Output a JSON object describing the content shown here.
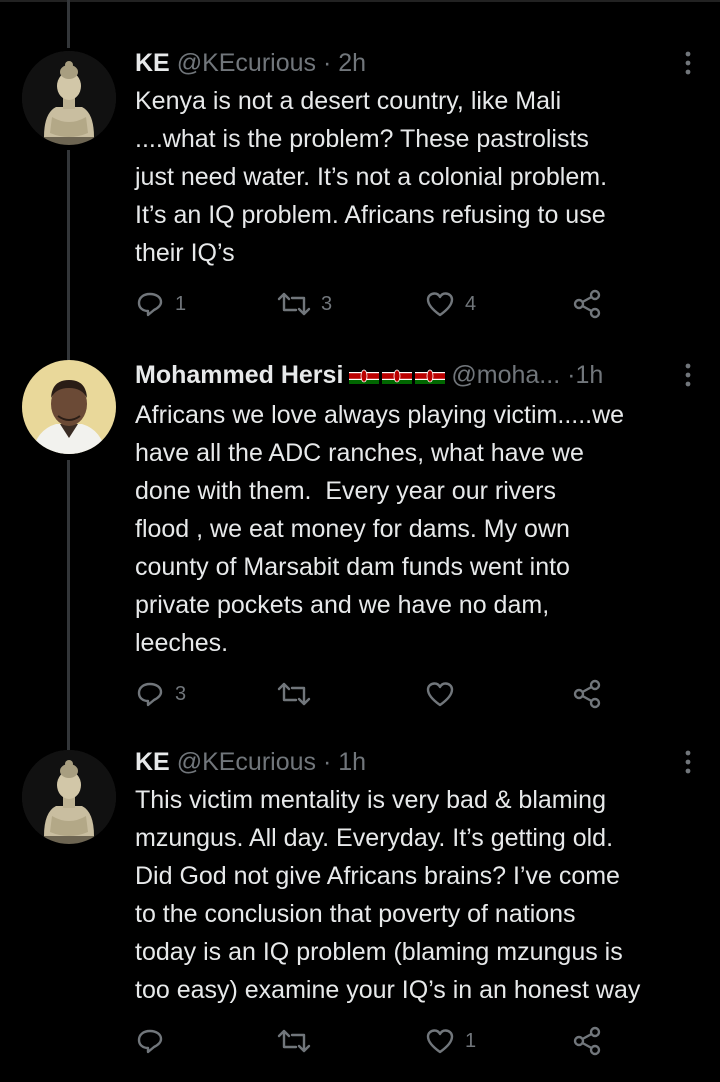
{
  "tweets": [
    {
      "name": "KE",
      "handle": "@KEcurious",
      "separator": "·",
      "time": "2h",
      "avatar_icon": "buddha-statue-avatar",
      "text": "Kenya is not a desert country, like Mali\n....what is the problem? These pastrolists\njust need water. It’s not a colonial problem.\nIt’s an IQ problem. Africans refusing to use\ntheir IQ’s",
      "replies": "1",
      "retweets": "3",
      "likes": "4"
    },
    {
      "name": "Mohammed Hersi",
      "handle": "@moha...",
      "separator": "·",
      "time": "1h",
      "avatar_icon": "profile-photo-avatar",
      "flags": "kenya-flag-icons",
      "text": "Africans we love always playing victim.....we\nhave all the ADC ranches, what have we\ndone with them.  Every year our rivers\nflood , we eat money for dams. My own\ncounty of Marsabit dam funds went into\nprivate pockets and we have no dam,\nleeches.",
      "replies": "3",
      "retweets": "",
      "likes": ""
    },
    {
      "name": "KE",
      "handle": "@KEcurious",
      "separator": "·",
      "time": "1h",
      "avatar_icon": "buddha-statue-avatar",
      "text": "This victim mentality is very bad & blaming\nmzungus. All day. Everyday. It’s getting old.\nDid God not give Africans brains? I’ve come\nto the conclusion that poverty of nations\ntoday is an IQ problem (blaming mzungus is\ntoo easy) examine your IQ’s in an honest way",
      "replies": "",
      "retweets": "",
      "likes": "1"
    }
  ],
  "colors": {
    "background": "#000000",
    "text": "#e7e9ea",
    "muted": "#71767b",
    "thread_line": "#333639"
  }
}
